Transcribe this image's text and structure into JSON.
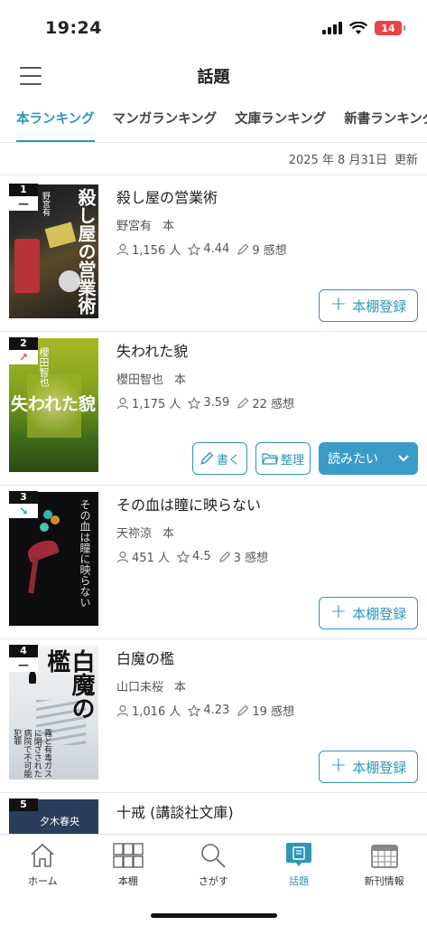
{
  "status": {
    "time": "19:24",
    "battery": "14"
  },
  "header": {
    "title": "話題"
  },
  "tabs": [
    "本ランキング",
    "マンガランキング",
    "文庫ランキング",
    "新書ランキング"
  ],
  "updated": {
    "date": "2025 年 8 月31日",
    "label": "更新"
  },
  "books": [
    {
      "rank": "1",
      "trend": "—",
      "title": "殺し屋の営業術",
      "author": "野宮有",
      "format": "本",
      "readers": "1,156 人",
      "rating": "4.44",
      "reviews": "9 感想",
      "action": "本棚登録",
      "cover_title": "殺し屋の営業術",
      "cover_author": "野宮有"
    },
    {
      "rank": "2",
      "trend": "↗",
      "title": "失われた貌",
      "author": "櫻田智也",
      "format": "本",
      "readers": "1,175 人",
      "rating": "3.59",
      "reviews": "22 感想",
      "write": "書く",
      "organize": "整理",
      "want": "読みたい",
      "cover_title": "失われた貌",
      "cover_author": "櫻田智也"
    },
    {
      "rank": "3",
      "trend": "↘",
      "title": "その血は瞳に映らない",
      "author": "天祢涼",
      "format": "本",
      "readers": "451 人",
      "rating": "4.5",
      "reviews": "3 感想",
      "action": "本棚登録",
      "cover_title": "その血は瞳に映らない"
    },
    {
      "rank": "4",
      "trend": "—",
      "title": "白魔の檻",
      "author": "山口未桜",
      "format": "本",
      "readers": "1,016 人",
      "rating": "4.23",
      "reviews": "19 感想",
      "action": "本棚登録",
      "cover_title": "白魔の檻",
      "cover_copy": "霧と有毒ガスに閉ざされた病院で不可能犯罪"
    },
    {
      "rank": "5",
      "trend": "",
      "title": "十戒 (講談社文庫)",
      "cover_author": "夕木春央"
    }
  ],
  "tabbar": [
    {
      "label": "ホーム",
      "icon": "home-icon"
    },
    {
      "label": "本棚",
      "icon": "bookshelf-icon"
    },
    {
      "label": "さがす",
      "icon": "search-icon"
    },
    {
      "label": "話題",
      "icon": "topic-icon"
    },
    {
      "label": "新刊情報",
      "icon": "calendar-icon"
    }
  ],
  "colors": {
    "accent": "#2e97b8",
    "want_button": "#3b9bc8",
    "up": "#e25555"
  }
}
